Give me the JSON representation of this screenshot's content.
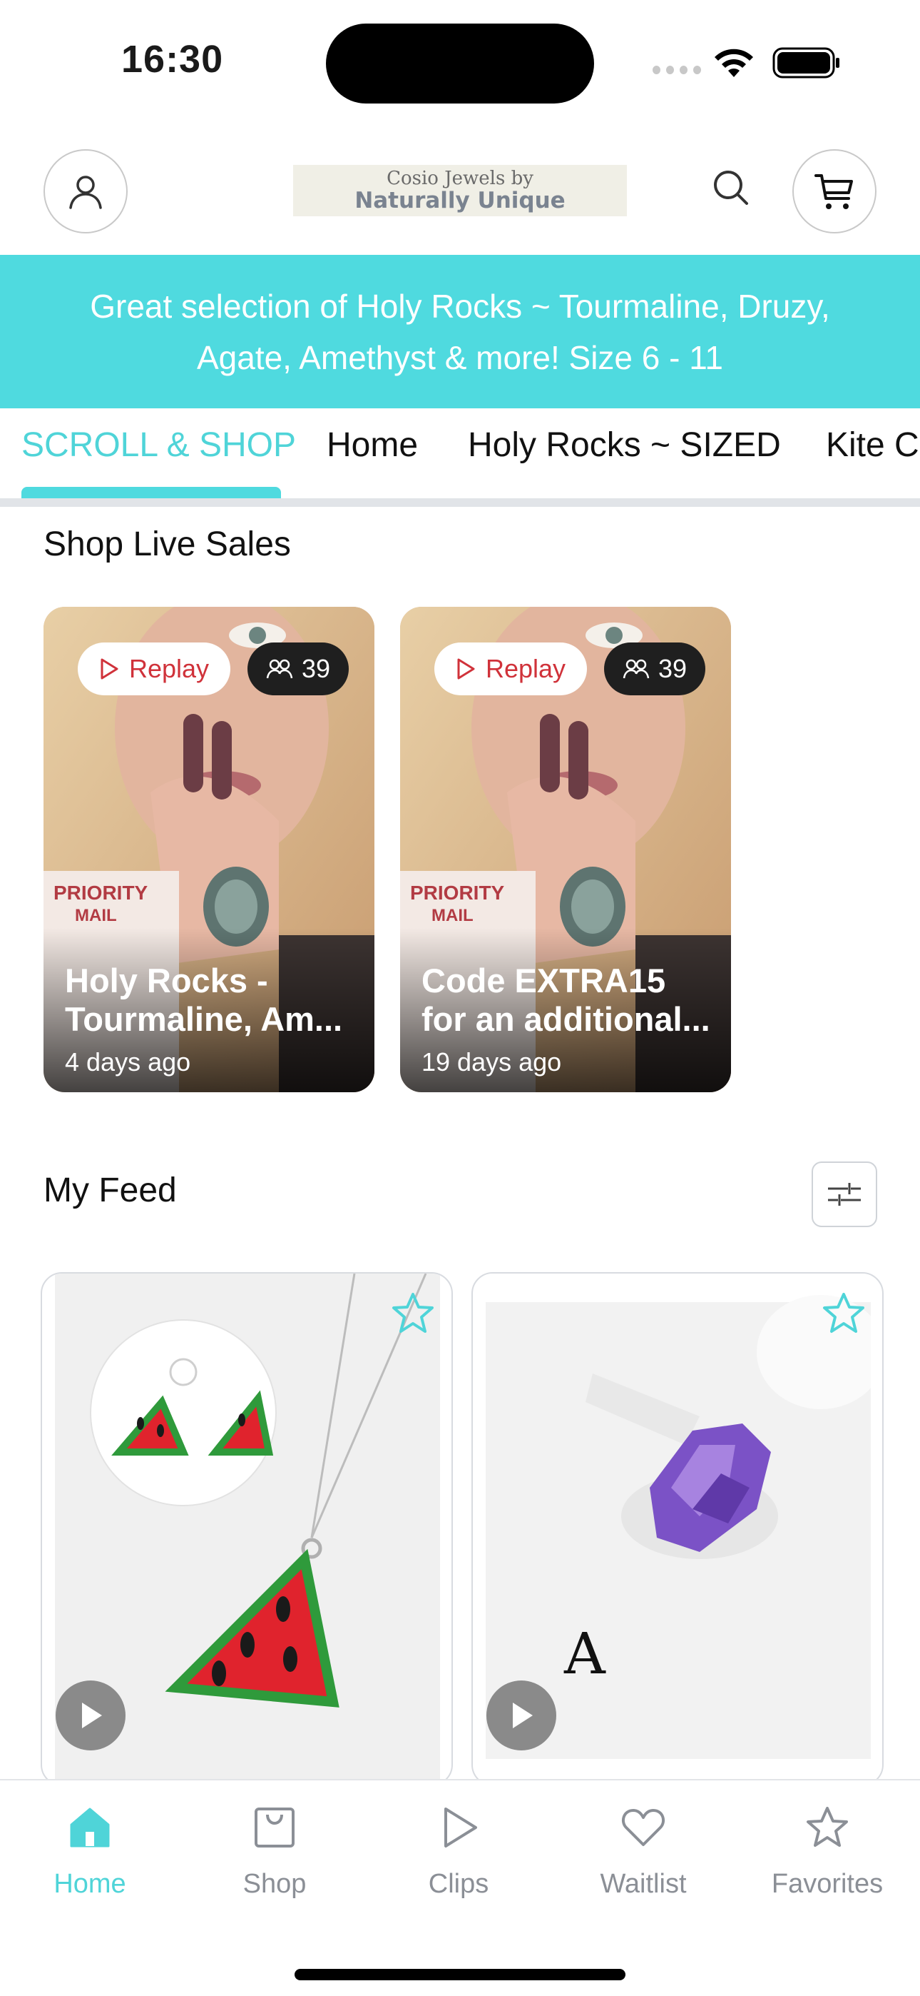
{
  "status_bar": {
    "time": "16:30",
    "icons": [
      "signal-icon",
      "wifi-icon",
      "battery-icon"
    ]
  },
  "header": {
    "logo_line1": "Cosio Jewels by",
    "logo_line2": "Naturally Unique",
    "icons": [
      "account-icon",
      "search-icon",
      "cart-icon"
    ]
  },
  "banner": {
    "text": "Great selection of Holy Rocks ~  Tourmaline, Druzy, Agate, Amethyst & more! Size 6  - 11"
  },
  "tabs": [
    {
      "label": "SCROLL & SHOP",
      "active": true
    },
    {
      "label": "Home",
      "active": false
    },
    {
      "label": "Holy Rocks ~ SIZED",
      "active": false
    },
    {
      "label": "Kite C",
      "active": false
    }
  ],
  "live_sales": {
    "title": "Shop Live Sales",
    "cards": [
      {
        "replay_label": "Replay",
        "viewers": "39",
        "title_line1": "Holy Rocks -",
        "title_line2": "Tourmaline, Am...",
        "time": "4 days ago"
      },
      {
        "replay_label": "Replay",
        "viewers": "39",
        "title_line1": "Code EXTRA15",
        "title_line2": "for an additional...",
        "time": "19 days ago"
      }
    ]
  },
  "feed": {
    "title": "My Feed",
    "cards": [
      {
        "image": "watermelon-jewelry",
        "has_video": true,
        "favorited": false
      },
      {
        "image": "amethyst-ring",
        "has_video": true,
        "favorited": false
      }
    ]
  },
  "bottom_nav": [
    {
      "label": "Home",
      "icon": "home-icon",
      "active": true
    },
    {
      "label": "Shop",
      "icon": "shop-icon",
      "active": false
    },
    {
      "label": "Clips",
      "icon": "clips-icon",
      "active": false
    },
    {
      "label": "Waitlist",
      "icon": "heart-icon",
      "active": false
    },
    {
      "label": "Favorites",
      "icon": "star-icon",
      "active": false
    }
  ],
  "colors": {
    "accent": "#4fdadf",
    "replay_red": "#d0323a",
    "nav_inactive": "#8b8f96"
  }
}
